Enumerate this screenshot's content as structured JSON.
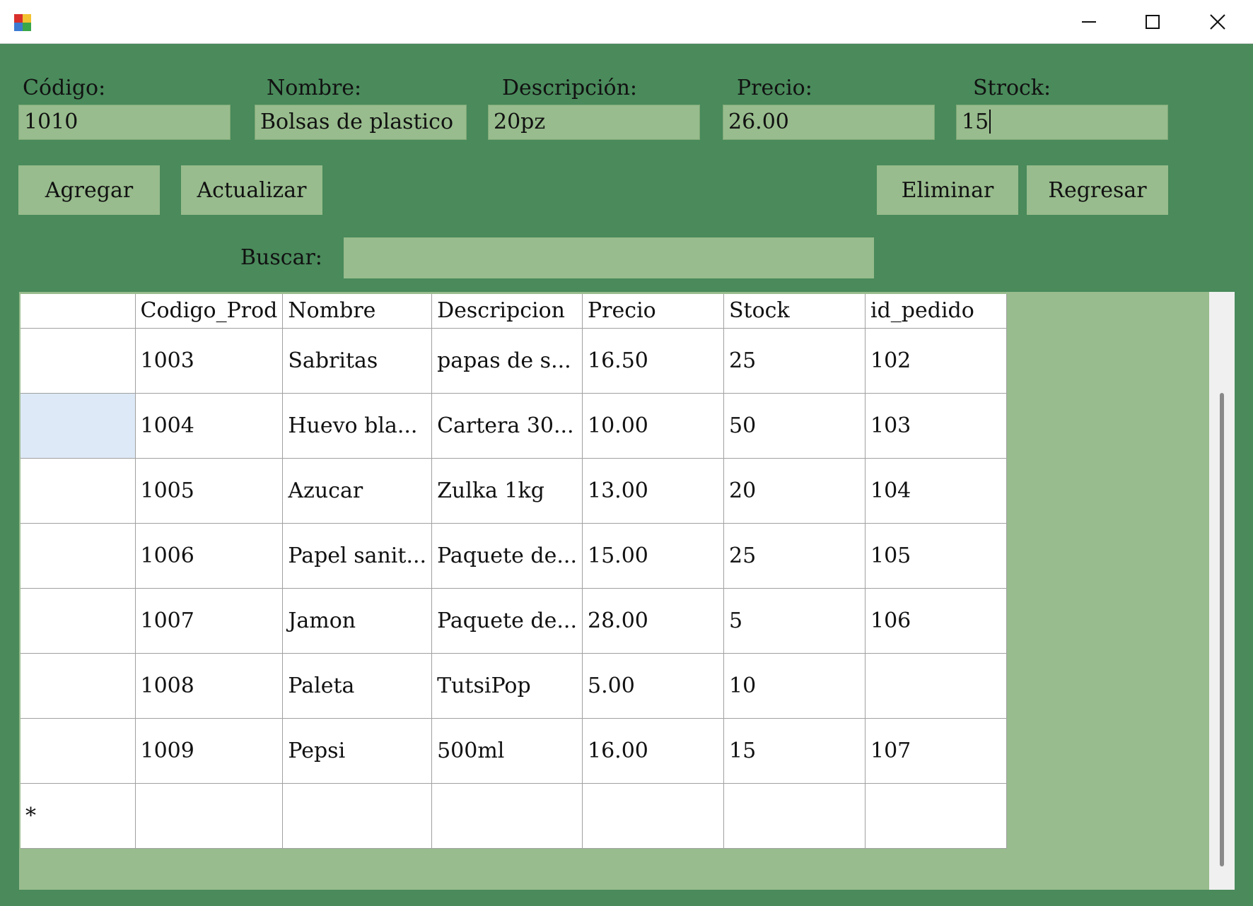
{
  "window": {
    "title": "",
    "minimize_glyph": "minimize-icon",
    "maximize_glyph": "maximize-icon",
    "close_glyph": "close-icon"
  },
  "form": {
    "codigo": {
      "label": "Código:",
      "value": "1010"
    },
    "nombre": {
      "label": "Nombre:",
      "value": "Bolsas de plastico"
    },
    "descripcion": {
      "label": "Descripción:",
      "value": "20pz"
    },
    "precio": {
      "label": "Precio:",
      "value": "26.00"
    },
    "stock": {
      "label": "Strock:",
      "value": "15"
    }
  },
  "buttons": {
    "agregar": "Agregar",
    "actualizar": "Actualizar",
    "eliminar": "Eliminar",
    "regresar": "Regresar"
  },
  "search": {
    "label": "Buscar:",
    "value": ""
  },
  "grid": {
    "columns": [
      "Codigo_Prod",
      "Nombre",
      "Descripcion",
      "Precio",
      "Stock",
      "id_pedido"
    ],
    "rows": [
      [
        "1003",
        "Sabritas",
        "papas de s...",
        "16.50",
        "25",
        "102"
      ],
      [
        "1004",
        "Huevo bla...",
        "Cartera 30...",
        "10.00",
        "50",
        "103"
      ],
      [
        "1005",
        "Azucar",
        "Zulka 1kg",
        "13.00",
        "20",
        "104"
      ],
      [
        "1006",
        "Papel sanit...",
        "Paquete de...",
        "15.00",
        "25",
        "105"
      ],
      [
        "1007",
        "Jamon",
        "Paquete de...",
        "28.00",
        "5",
        "106"
      ],
      [
        "1008",
        "Paleta",
        "TutsiPop",
        "5.00",
        "10",
        ""
      ],
      [
        "1009",
        "Pepsi",
        "500ml",
        "16.00",
        "15",
        "107"
      ]
    ],
    "new_row_marker": "*",
    "selected_row_index": 1
  },
  "colors": {
    "background": "#4a8a5b",
    "control": "#98bc8d",
    "selection": "#dde9f6"
  }
}
